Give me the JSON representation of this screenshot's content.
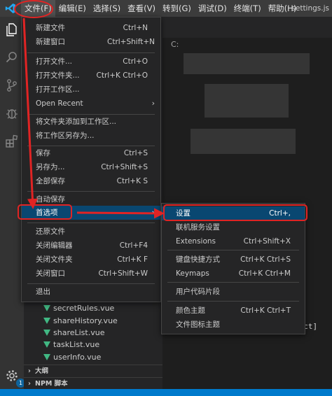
{
  "menubar": {
    "items": [
      "文件(F)",
      "编辑(E)",
      "选择(S)",
      "查看(V)",
      "转到(G)",
      "调试(D)",
      "终端(T)",
      "帮助(H)"
    ],
    "title": "settings.js"
  },
  "activity": {
    "badge": "1"
  },
  "editor": {
    "crumb": "C:",
    "code": "ject]"
  },
  "files": [
    "secretRules.vue",
    "shareHistory.vue",
    "shareList.vue",
    "taskList.vue",
    "userInfo.vue"
  ],
  "sections": [
    "大纲",
    "NPM 脚本"
  ],
  "file_menu": {
    "items": [
      {
        "label": "新建文件",
        "shortcut": "Ctrl+N"
      },
      {
        "label": "新建窗口",
        "shortcut": "Ctrl+Shift+N"
      },
      {
        "label": "打开文件...",
        "shortcut": "Ctrl+O"
      },
      {
        "label": "打开文件夹...",
        "shortcut": "Ctrl+K Ctrl+O"
      },
      {
        "label": "打开工作区...",
        "shortcut": ""
      },
      {
        "label": "Open Recent",
        "shortcut": ""
      },
      {
        "label": "将文件夹添加到工作区...",
        "shortcut": ""
      },
      {
        "label": "将工作区另存为...",
        "shortcut": ""
      },
      {
        "label": "保存",
        "shortcut": "Ctrl+S"
      },
      {
        "label": "另存为...",
        "shortcut": "Ctrl+Shift+S"
      },
      {
        "label": "全部保存",
        "shortcut": "Ctrl+K S"
      },
      {
        "label": "自动保存",
        "shortcut": ""
      },
      {
        "label": "首选项",
        "shortcut": ""
      },
      {
        "label": "还原文件",
        "shortcut": ""
      },
      {
        "label": "关闭编辑器",
        "shortcut": "Ctrl+F4"
      },
      {
        "label": "关闭文件夹",
        "shortcut": "Ctrl+K F"
      },
      {
        "label": "关闭窗口",
        "shortcut": "Ctrl+Shift+W"
      },
      {
        "label": "退出",
        "shortcut": ""
      }
    ]
  },
  "prefs_menu": {
    "items": [
      {
        "label": "设置",
        "shortcut": "Ctrl+,"
      },
      {
        "label": "联机服务设置",
        "shortcut": ""
      },
      {
        "label": "Extensions",
        "shortcut": "Ctrl+Shift+X"
      },
      {
        "label": "键盘快捷方式",
        "shortcut": "Ctrl+K Ctrl+S"
      },
      {
        "label": "Keymaps",
        "shortcut": "Ctrl+K Ctrl+M"
      },
      {
        "label": "用户代码片段",
        "shortcut": ""
      },
      {
        "label": "颜色主题",
        "shortcut": "Ctrl+K Ctrl+T"
      },
      {
        "label": "文件图标主题",
        "shortcut": ""
      }
    ]
  },
  "colors": {
    "accent": "#007acc",
    "highlight": "#094771",
    "annotation": "#e02424",
    "vue": "#41b883"
  }
}
